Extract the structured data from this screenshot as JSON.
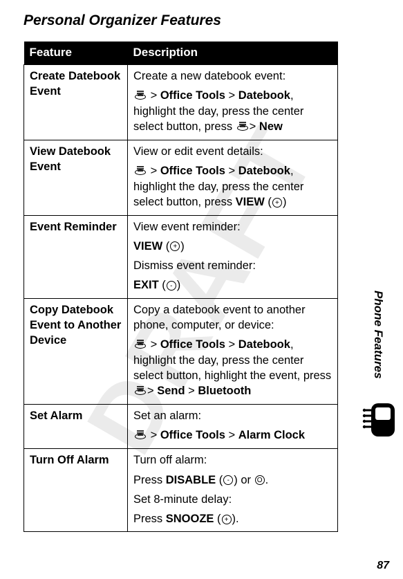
{
  "watermark": "DRAFT",
  "title": "Personal Organizer Features",
  "table": {
    "headers": {
      "feature": "Feature",
      "description": "Description"
    },
    "rows": [
      {
        "feature": "Create Datebook Event",
        "lines": [
          {
            "text": "Create a new datebook event:"
          },
          {
            "prefixIcon": true,
            "segments": [
              " > ",
              {
                "b": "Office Tools"
              },
              " > ",
              {
                "b": "Datebook"
              },
              ", highlight the day, press the center select button, press "
            ],
            "suffixIcon": true,
            "suffixSegments": [
              "> ",
              {
                "b": "New"
              }
            ]
          }
        ]
      },
      {
        "feature": "View Datebook Event",
        "lines": [
          {
            "text": "View or edit event details:"
          },
          {
            "prefixIcon": true,
            "segments": [
              " > ",
              {
                "b": "Office Tools"
              },
              " > ",
              {
                "b": "Datebook"
              },
              ", highlight the day, press the center select button, press ",
              {
                "b": "VIEW"
              },
              " (",
              {
                "key": "+"
              },
              ")"
            ]
          }
        ]
      },
      {
        "feature": "Event Reminder",
        "lines": [
          {
            "text": "View event reminder:"
          },
          {
            "segments": [
              {
                "b": "VIEW"
              },
              " (",
              {
                "key": "+"
              },
              ")"
            ]
          },
          {
            "text": "Dismiss event reminder:"
          },
          {
            "segments": [
              {
                "b": "EXIT"
              },
              " (",
              {
                "key": "-"
              },
              ")"
            ]
          }
        ]
      },
      {
        "feature": "Copy Datebook Event to Another Device",
        "lines": [
          {
            "text": "Copy a datebook event to another phone, computer, or device:"
          },
          {
            "prefixIcon": true,
            "segments": [
              " > ",
              {
                "b": "Office Tools"
              },
              " > ",
              {
                "b": "Datebook"
              },
              ", highlight the day, press the center select button, highlight the event, press "
            ],
            "suffixIcon": true,
            "suffixSegments": [
              "> ",
              {
                "b": "Send"
              },
              " > ",
              {
                "b": "Bluetooth"
              }
            ]
          }
        ]
      },
      {
        "feature": "Set Alarm",
        "lines": [
          {
            "text": "Set an alarm:"
          },
          {
            "prefixIcon": true,
            "segments": [
              " > ",
              {
                "b": "Office Tools"
              },
              " > ",
              {
                "b": "Alarm Clock"
              }
            ]
          }
        ]
      },
      {
        "feature": "Turn Off Alarm",
        "lines": [
          {
            "text": "Turn off alarm:"
          },
          {
            "segments": [
              "Press ",
              {
                "b": "DISABLE"
              },
              " (",
              {
                "key": "-"
              },
              ") or ",
              {
                "key": "O"
              },
              "."
            ]
          },
          {
            "text": "Set 8-minute delay:"
          },
          {
            "segments": [
              "Press ",
              {
                "b": "SNOOZE"
              },
              " (",
              {
                "key": "+"
              },
              ")."
            ]
          }
        ]
      }
    ]
  },
  "side_label": "Phone Features",
  "page_number": "87"
}
